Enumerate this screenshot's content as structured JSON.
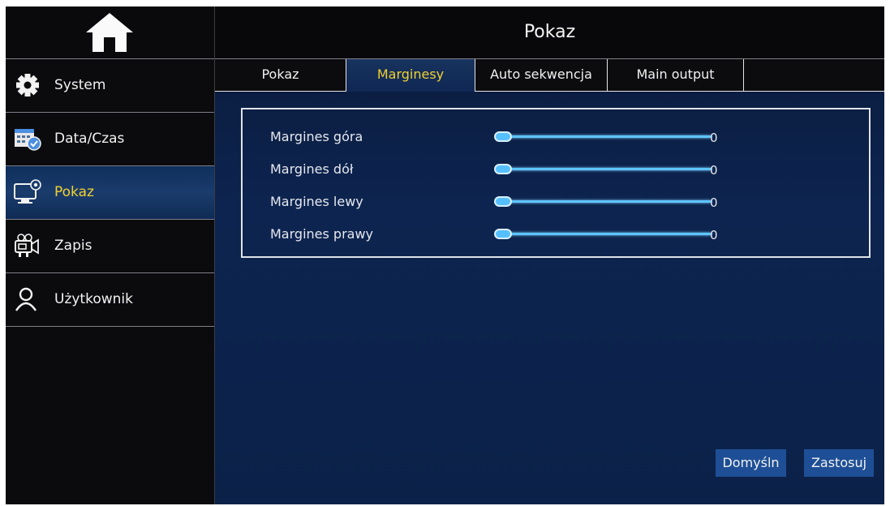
{
  "sidebar": {
    "home_icon": "home-icon",
    "items": [
      {
        "label": "System",
        "icon": "gear-icon",
        "active": false
      },
      {
        "label": "Data/Czas",
        "icon": "calendar-icon",
        "active": false
      },
      {
        "label": "Pokaz",
        "icon": "monitor-icon",
        "active": true
      },
      {
        "label": "Zapis",
        "icon": "recorder-icon",
        "active": false
      },
      {
        "label": "Użytkownik",
        "icon": "user-icon",
        "active": false
      }
    ]
  },
  "header": {
    "title": "Pokaz"
  },
  "tabs": [
    {
      "label": "Pokaz",
      "active": false
    },
    {
      "label": "Marginesy",
      "active": true
    },
    {
      "label": "Auto sekwencja",
      "active": false
    },
    {
      "label": "Main output",
      "active": false
    }
  ],
  "margins": [
    {
      "label": "Margines góra",
      "value": "0",
      "level": 0
    },
    {
      "label": "Margines dół",
      "value": "0",
      "level": 0
    },
    {
      "label": "Margines lewy",
      "value": "0",
      "level": 0
    },
    {
      "label": "Margines prawy",
      "value": "0",
      "level": 0
    }
  ],
  "buttons": {
    "default_label": "Domyśln",
    "apply_label": "Zastosuj"
  },
  "colors": {
    "active_text": "#f0d030",
    "slider": "#56c0ff",
    "button": "#1e4f96"
  }
}
